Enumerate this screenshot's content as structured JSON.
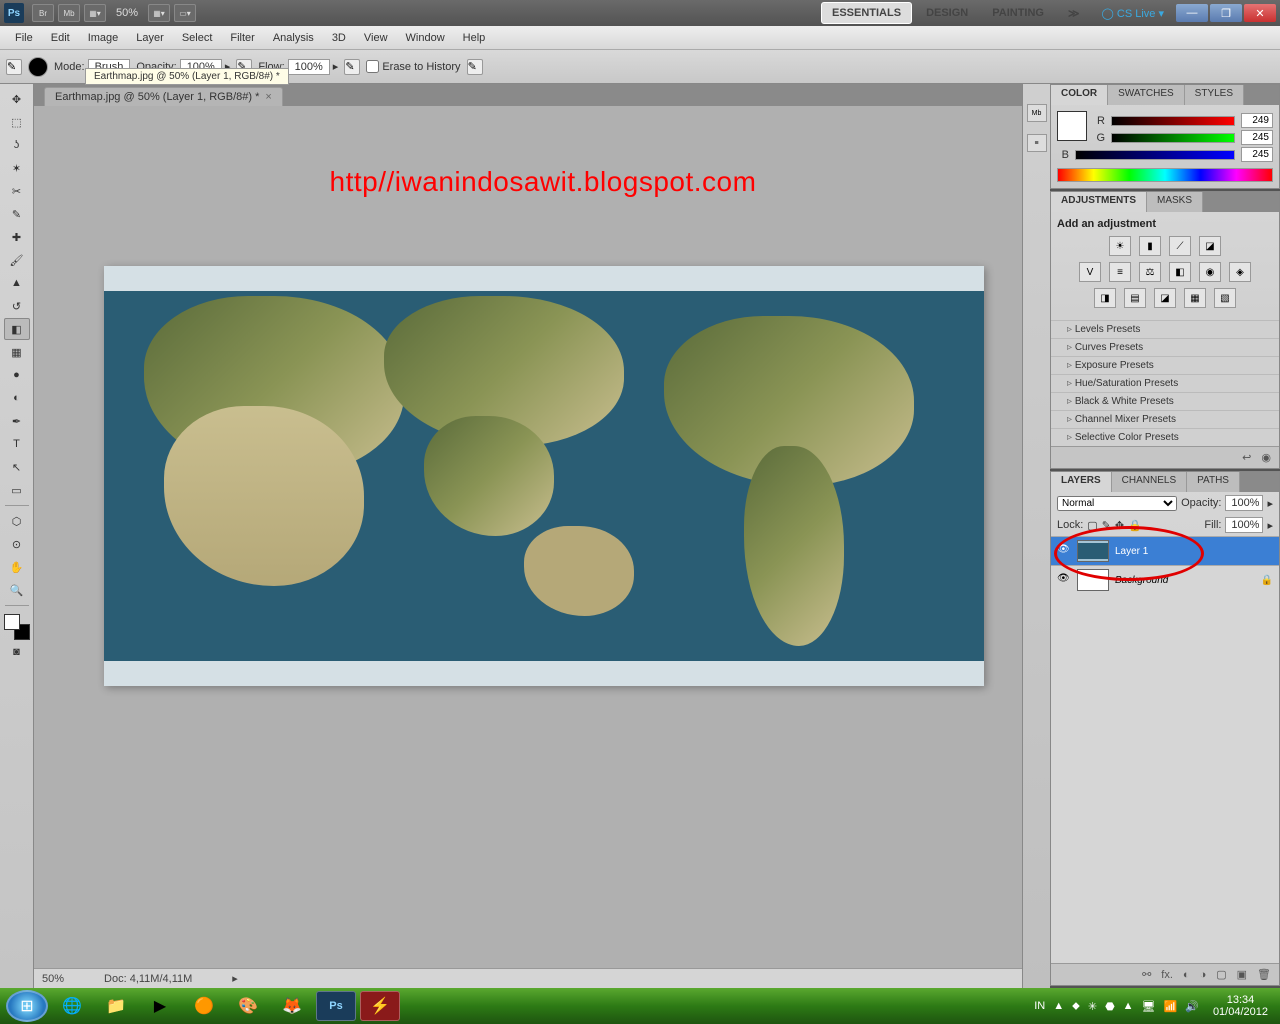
{
  "titlebar": {
    "app": "Ps",
    "zoom": "50%",
    "workspaces": [
      "ESSENTIALS",
      "DESIGN",
      "PAINTING"
    ],
    "cslive": "CS Live"
  },
  "menu": [
    "File",
    "Edit",
    "Image",
    "Layer",
    "Select",
    "Filter",
    "Analysis",
    "3D",
    "View",
    "Window",
    "Help"
  ],
  "optbar": {
    "mode_label": "Mode:",
    "mode_val": "Brush",
    "opacity_label": "Opacity:",
    "opacity_val": "100%",
    "flow_label": "Flow:",
    "flow_val": "100%",
    "erase_history": "Erase to History",
    "tooltip": "Earthmap.jpg @ 50% (Layer 1, RGB/8#) *"
  },
  "doc": {
    "tab": "Earthmap.jpg @ 50% (Layer 1, RGB/8#) *",
    "watermark": "http//iwanindosawit.blogspot.com",
    "status_zoom": "50%",
    "status_doc": "Doc: 4,11M/4,11M"
  },
  "color": {
    "tabs": [
      "COLOR",
      "SWATCHES",
      "STYLES"
    ],
    "r_label": "R",
    "r": "249",
    "g_label": "G",
    "g": "245",
    "b_label": "B",
    "b": "245"
  },
  "adjustments": {
    "tabs": [
      "ADJUSTMENTS",
      "MASKS"
    ],
    "header": "Add an adjustment",
    "presets": [
      "Levels Presets",
      "Curves Presets",
      "Exposure Presets",
      "Hue/Saturation Presets",
      "Black & White Presets",
      "Channel Mixer Presets",
      "Selective Color Presets"
    ]
  },
  "layers": {
    "tabs": [
      "LAYERS",
      "CHANNELS",
      "PATHS"
    ],
    "blend": "Normal",
    "opacity_label": "Opacity:",
    "opacity": "100%",
    "lock_label": "Lock:",
    "fill_label": "Fill:",
    "fill": "100%",
    "rows": [
      {
        "name": "Layer 1",
        "locked": false,
        "sel": true
      },
      {
        "name": "Background",
        "locked": true,
        "sel": false
      }
    ]
  },
  "taskbar": {
    "lang": "IN",
    "time": "13:34",
    "date": "01/04/2012"
  }
}
